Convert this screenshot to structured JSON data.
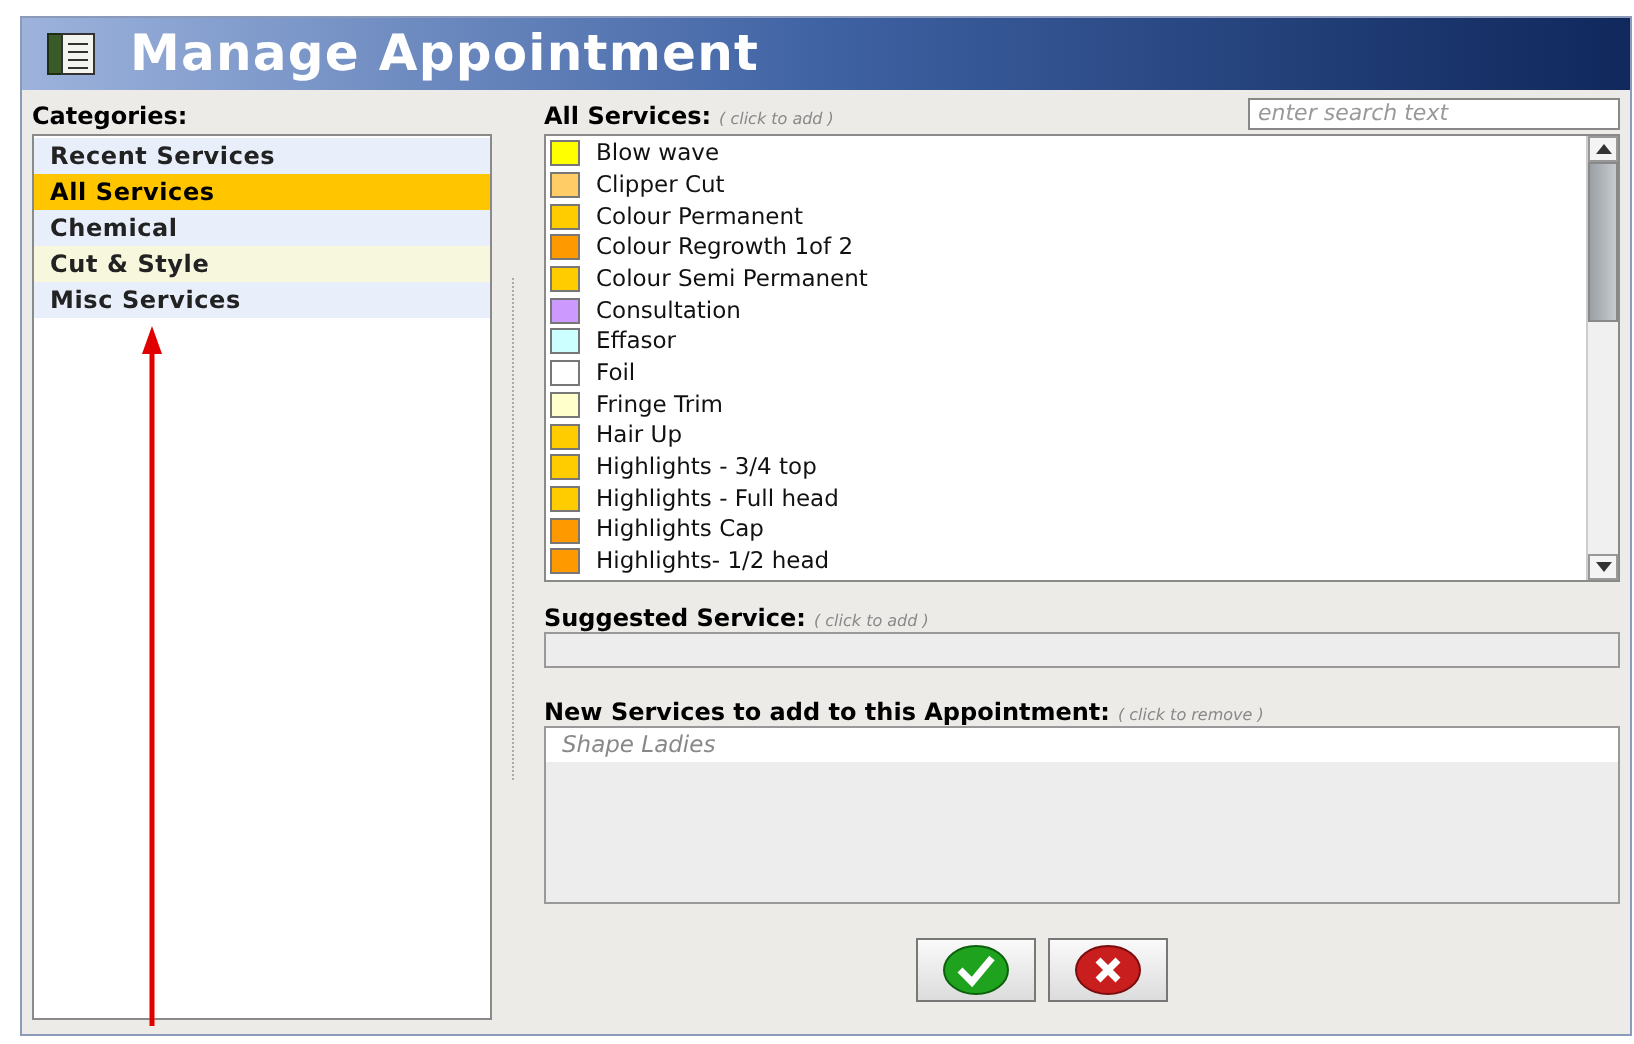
{
  "window": {
    "title": "Manage Appointment"
  },
  "categories": {
    "label": "Categories:",
    "items": [
      {
        "label": "Recent Services",
        "selected": false,
        "color": "#e8eefa"
      },
      {
        "label": "All Services",
        "selected": true,
        "color": "#ffc600"
      },
      {
        "label": "Chemical",
        "selected": false,
        "color": "#e8eefa"
      },
      {
        "label": "Cut & Style",
        "selected": false,
        "color": "#f6f7dc"
      },
      {
        "label": "Misc Services",
        "selected": false,
        "color": "#e8eefa"
      }
    ]
  },
  "all_services": {
    "label": "All Services:",
    "hint": "( click to add )",
    "search": {
      "placeholder": "enter search text"
    },
    "items": [
      {
        "label": "Blow wave",
        "color": "#ffff00"
      },
      {
        "label": "Clipper Cut",
        "color": "#ffcc66"
      },
      {
        "label": "Colour Permanent",
        "color": "#ffcc00"
      },
      {
        "label": "Colour Regrowth 1of 2",
        "color": "#ff9900"
      },
      {
        "label": "Colour Semi Permanent",
        "color": "#ffcc00"
      },
      {
        "label": "Consultation",
        "color": "#cc99ff"
      },
      {
        "label": "Effasor",
        "color": "#ccffff"
      },
      {
        "label": "Foil",
        "color": "#ffffff"
      },
      {
        "label": "Fringe Trim",
        "color": "#ffffcc"
      },
      {
        "label": "Hair Up",
        "color": "#ffcc00"
      },
      {
        "label": "Highlights - 3/4 top",
        "color": "#ffcc00"
      },
      {
        "label": "Highlights - Full head",
        "color": "#ffcc00"
      },
      {
        "label": "Highlights Cap",
        "color": "#ff9900"
      },
      {
        "label": "Highlights- 1/2 head",
        "color": "#ff9900"
      }
    ]
  },
  "suggested_service": {
    "label": "Suggested Service:",
    "hint": "( click to add )"
  },
  "new_services": {
    "label": "New Services to add to this Appointment:",
    "hint": "( click to remove )",
    "items": [
      "Shape Ladies"
    ]
  }
}
